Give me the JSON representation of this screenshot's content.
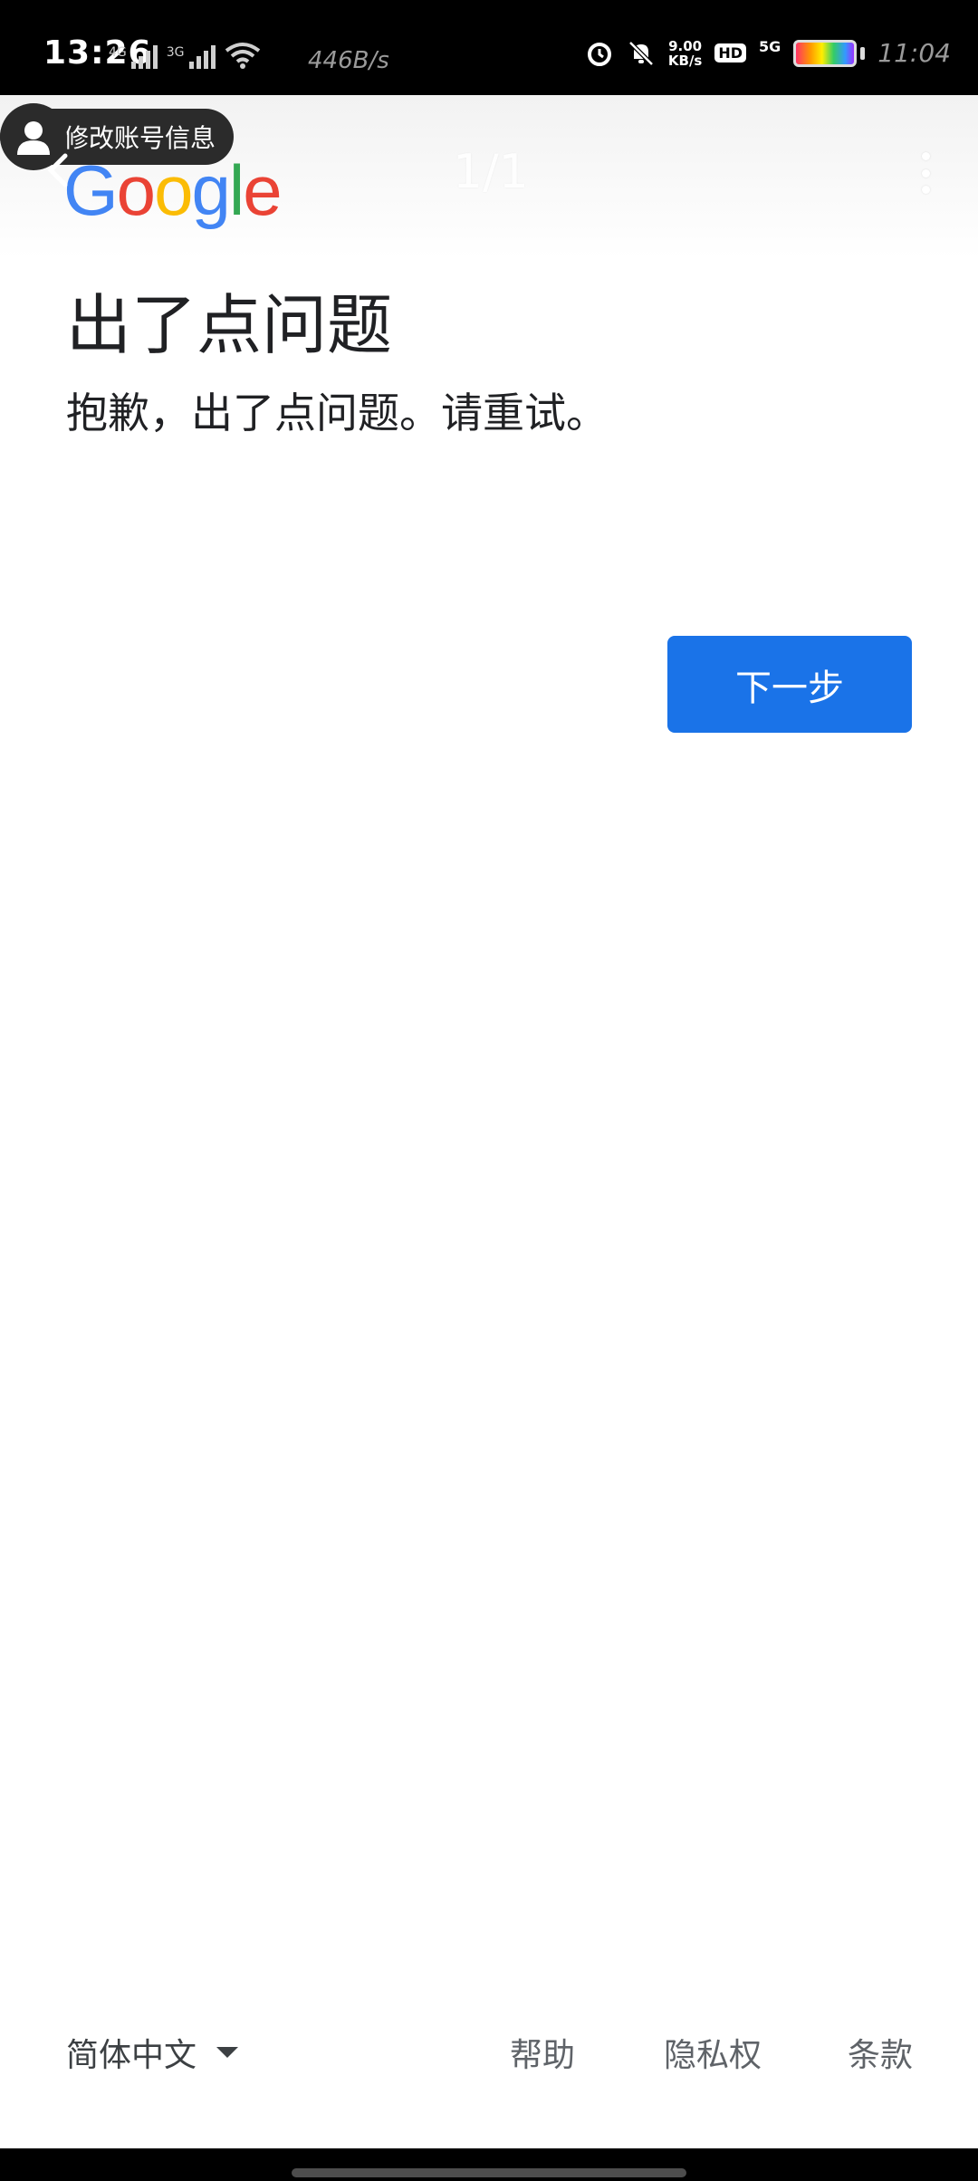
{
  "status_bar": {
    "time": "13:26",
    "signal1_label": "4G",
    "signal2_label": "3G",
    "speed_left": "446B/s",
    "speed_value": "9.00",
    "speed_unit": "KB/s",
    "hd_label": "HD",
    "network_label": "5G",
    "clock_right": "11:04"
  },
  "header": {
    "account_chip_label": "修改账号信息",
    "logo_letters": [
      "G",
      "o",
      "o",
      "g",
      "l",
      "e"
    ],
    "logo_colors": [
      "#4285F4",
      "#EA4335",
      "#FBBC05",
      "#4285F4",
      "#34A853",
      "#EA4335"
    ],
    "page_counter": "1/1"
  },
  "content": {
    "title": "出了点问题",
    "message": "抱歉，出了点问题。请重试。",
    "next_button": "下一步"
  },
  "footer": {
    "language": "简体中文",
    "help": "帮助",
    "privacy": "隐私权",
    "terms": "条款"
  },
  "colors": {
    "primary_button": "#1a73e8",
    "text_primary": "#202124",
    "text_secondary": "#5f6368"
  }
}
